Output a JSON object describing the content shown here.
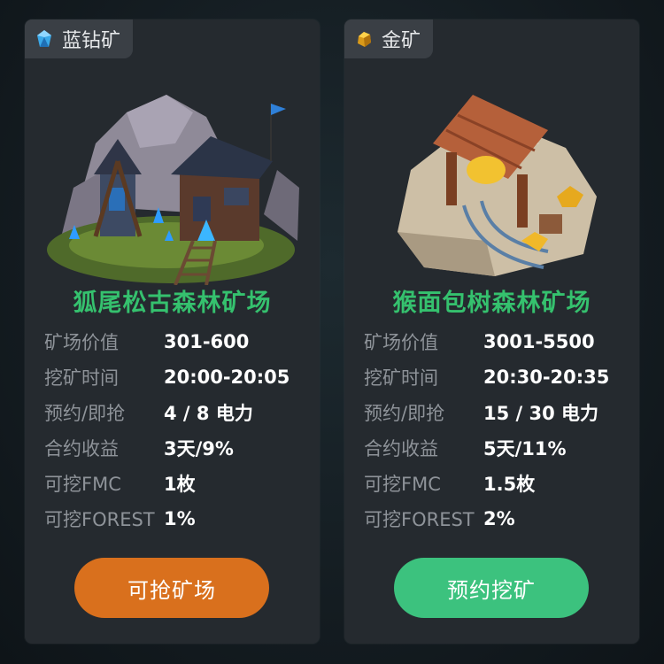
{
  "cards": [
    {
      "tag": "蓝钻矿",
      "tag_icon": "blue-diamond-icon",
      "name": "狐尾松古森林矿场",
      "rows": [
        {
          "label": "矿场价值",
          "value": "301-600"
        },
        {
          "label": "挖矿时间",
          "value": "20:00-20:05"
        },
        {
          "label": "预约/即抢",
          "value": "4 / 8 电力"
        },
        {
          "label": "合约收益",
          "value": "3天/9%"
        },
        {
          "label": "可挖FMC",
          "value": "1枚"
        },
        {
          "label": "可挖FOREST",
          "value": "1%"
        }
      ],
      "button": "可抢矿场",
      "button_color": "#d9701d"
    },
    {
      "tag": "金矿",
      "tag_icon": "gold-ore-icon",
      "name": "猴面包树森林矿场",
      "rows": [
        {
          "label": "矿场价值",
          "value": "3001-5500"
        },
        {
          "label": "挖矿时间",
          "value": "20:30-20:35"
        },
        {
          "label": "预约/即抢",
          "value": "15 / 30 电力"
        },
        {
          "label": "合约收益",
          "value": "5天/11%"
        },
        {
          "label": "可挖FMC",
          "value": "1.5枚"
        },
        {
          "label": "可挖FOREST",
          "value": "2%"
        }
      ],
      "button": "预约挖矿",
      "button_color": "#3cc27e"
    }
  ],
  "colors": {
    "name_green": "#35c16e",
    "card_bg": "#252a2f",
    "label_gray": "#8e9399"
  }
}
